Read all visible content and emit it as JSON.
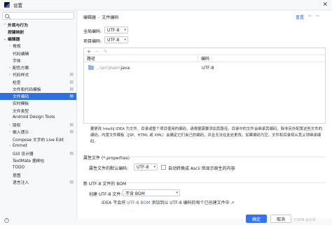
{
  "window": {
    "title": "设置",
    "close_glyph": "✕"
  },
  "sidebar": {
    "search_placeholder": "",
    "items": [
      {
        "label": "外观与行为",
        "arrow": "›",
        "bold": true
      },
      {
        "label": "按键映射",
        "arrow": "",
        "bold": true
      },
      {
        "label": "编辑器",
        "arrow": "⌄",
        "bold": true
      },
      {
        "label": "常规",
        "arrow": "›",
        "indent": 1
      },
      {
        "label": "代码编辑",
        "arrow": "",
        "indent": 1
      },
      {
        "label": "字体",
        "arrow": "",
        "indent": 1
      },
      {
        "label": "配色方案",
        "arrow": "›",
        "indent": 1
      },
      {
        "label": "代码样式",
        "arrow": "›",
        "indent": 1,
        "gear": true
      },
      {
        "label": "检查",
        "arrow": "",
        "indent": 1,
        "gear": true
      },
      {
        "label": "文件和代码模板",
        "arrow": "",
        "indent": 1,
        "gear": true
      },
      {
        "label": "文件编码",
        "arrow": "",
        "indent": 1,
        "gear": true,
        "selected": true
      },
      {
        "label": "实时模板",
        "arrow": "",
        "indent": 1
      },
      {
        "label": "文件类型",
        "arrow": "",
        "indent": 1
      },
      {
        "label": "Android Design Tools",
        "arrow": "",
        "indent": 1
      },
      {
        "label": "版权",
        "arrow": "›",
        "indent": 1,
        "gear": true
      },
      {
        "label": "嵌入提示",
        "arrow": "›",
        "indent": 1,
        "gear": true
      },
      {
        "label": "Compose 文字的 Live Edit",
        "arrow": "",
        "indent": 1
      },
      {
        "label": "Emmet",
        "arrow": "›",
        "indent": 1
      },
      {
        "label": "GUI 设计器",
        "arrow": "",
        "indent": 1,
        "gear": true
      },
      {
        "label": "TextMate 捆绑包",
        "arrow": "",
        "indent": 1
      },
      {
        "label": "TODO",
        "arrow": "",
        "indent": 1
      },
      {
        "label": "意图",
        "arrow": "",
        "indent": 1
      },
      {
        "label": "语言注入",
        "arrow": "",
        "indent": 1,
        "gear": true
      }
    ]
  },
  "main": {
    "breadcrumb": [
      "编辑器",
      "文件编码"
    ],
    "reset_label": "重置",
    "global_label": "全局编码:",
    "global_value": "UTF-8",
    "project_label": "项目编码:",
    "project_value": "UTF-8",
    "toolbar": {
      "add": "+",
      "remove": "−",
      "edit": "✎"
    },
    "table": {
      "columns": [
        "路径",
        "编码"
      ],
      "rows": [
        {
          "path_dim": "...\\src\\main\\",
          "path": "java",
          "encoding": "UTF-8"
        }
      ]
    },
    "description": "要更改 IntelliJ IDEA 为文件、目录或整个项目使用的编码，请根据需要添加其路径。目录中的文件会继承其编码，除非另外配置这些文件的编码。内置文件模板（JSP、HTML 或 XML）会确定它们自己的编码，并且无法在此处更改。如果编码为空，文件和目录将从其父项继承编码。",
    "properties_title": "属性文件 (*.properties)",
    "properties_label": "属性文件的默认编码:",
    "properties_value": "UTF-8",
    "native_label": "自动转换成 Ascii 但显示原生的内容",
    "bom_title": "新 UTF-8 文件的 BOM",
    "bom_label": "创建 UTF-8 文件:",
    "bom_value": "不含 BOM",
    "info_pre": "IDEA 不会将 ",
    "info_link": "UTF-8 BOM",
    "info_post": " 添加到以 UTF-8 编码的每个已创建文件中 ↗"
  },
  "footer": {
    "ok": "确定",
    "cancel": "取消",
    "help": "?"
  },
  "watermark": "CSDN @大爷"
}
